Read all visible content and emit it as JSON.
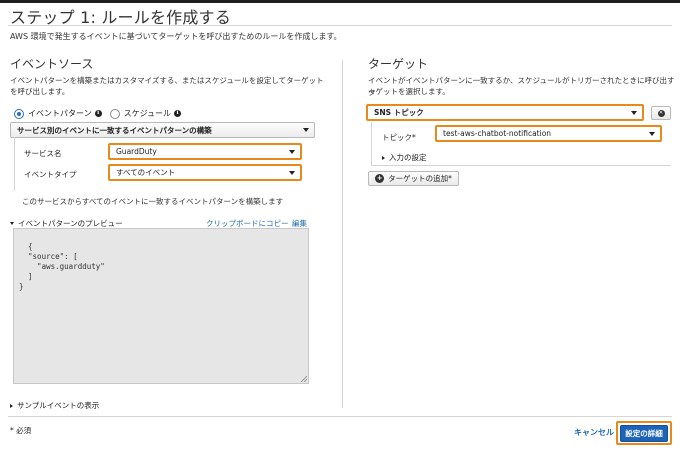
{
  "page": {
    "title": "ステップ 1: ルールを作成する",
    "description": "AWS 環境で発生するイベントに基づいてターゲットを呼び出すためのルールを作成します。"
  },
  "event_source": {
    "heading": "イベントソース",
    "description_line1": "イベントパターンを構築またはカスタマイズする、またはスケジュールを設定してターゲット",
    "description_line2": "を呼び出します。",
    "radio_event_pattern": "イベントパターン",
    "radio_schedule": "スケジュール",
    "selected_radio": "イベントパターン",
    "pattern_builder_select": "サービス別のイベントに一致するイベントパターンの構築",
    "service_name_label": "サービス名",
    "service_name_value": "GuardDuty",
    "event_type_label": "イベントタイプ",
    "event_type_value": "すべてのイベント",
    "note": "このサービスからすべてのイベントに一致するイベントパターンを構築します",
    "preview_label": "イベントパターンのプレビュー",
    "copy_link": "クリップボードにコピー",
    "edit_link": "編集",
    "preview_code": "{\n  \"source\": [\n    \"aws.guardduty\"\n  ]\n}",
    "sample_events": "サンプルイベントの表示"
  },
  "target": {
    "heading": "ターゲット",
    "description_line1": "イベントがイベントパターンに一致するか、スケジュールがトリガーされたときに呼び出すタ",
    "description_line2": "ーゲットを選択します。",
    "target_type_value": "SNS トピック",
    "topic_label": "トピック*",
    "topic_value": "test-aws-chatbot-notification",
    "input_settings": "入力の設定",
    "add_target_button": "ターゲットの追加*"
  },
  "footer": {
    "required_note": "* 必須",
    "cancel": "キャンセル",
    "configure_details": "設定の詳細"
  },
  "colors": {
    "highlight": "#e8891c",
    "primary": "#1d64b8",
    "link": "#1f6cb0"
  }
}
